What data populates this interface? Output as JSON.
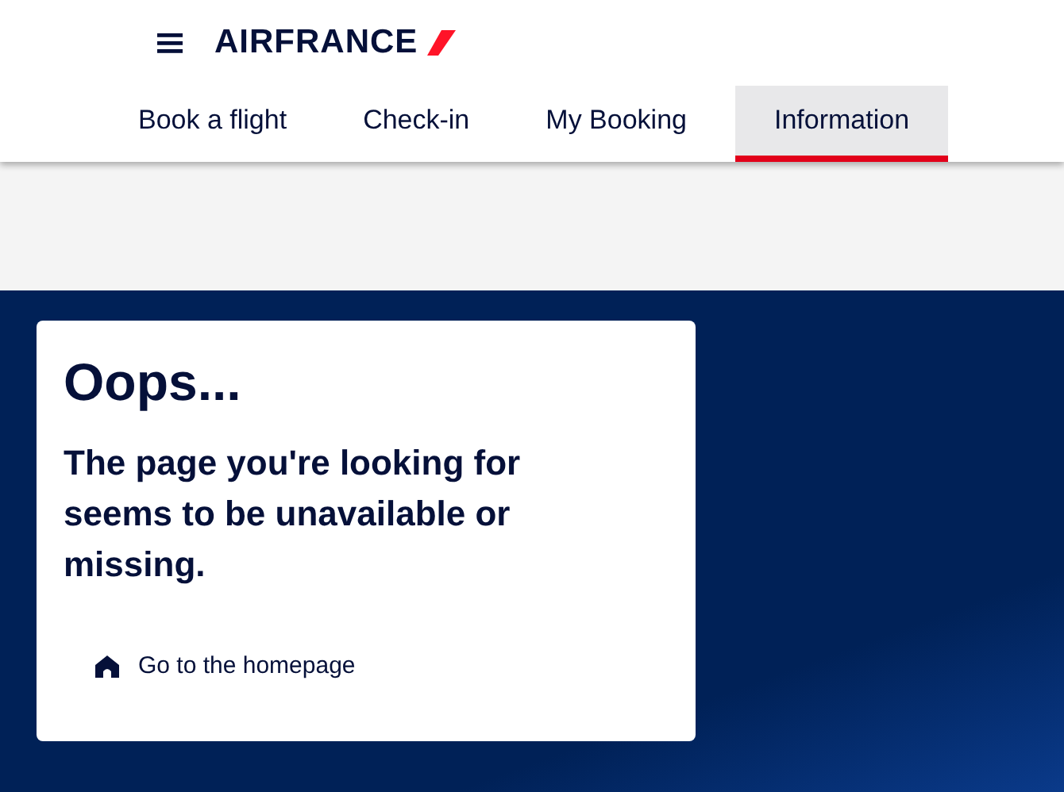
{
  "header": {
    "logo": "AIRFRANCE"
  },
  "tabs": [
    {
      "label": "Book a flight",
      "selected": false
    },
    {
      "label": "Check-in",
      "selected": false
    },
    {
      "label": "My Booking",
      "selected": false
    },
    {
      "label": "Information",
      "selected": true
    }
  ],
  "error_card": {
    "title": "Oops...",
    "message": "The page you're looking for seems to be unavailable or missing.",
    "link": "Go to the homepage"
  }
}
